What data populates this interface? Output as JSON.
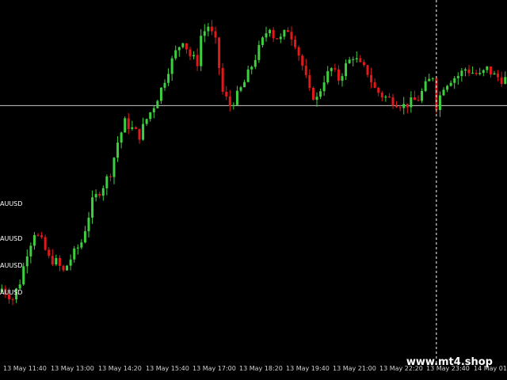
{
  "colors": {
    "background": "#000000",
    "bull": "#3ecf3e",
    "bear": "#e01a1a",
    "hline": "#c8c8c8",
    "crosshair": "#ffffff",
    "text": "#ffffff"
  },
  "side_labels": [
    "AUUSD",
    "AUUSD",
    "AUUSD",
    "AUUSD"
  ],
  "watermark": "www.mt4.shop",
  "chart_data": {
    "type": "candlestick",
    "symbol_labels": [
      "AUUSD",
      "AUUSD",
      "AUUSD",
      "AUUSD"
    ],
    "x_ticks": [
      "13 May 11:40",
      "13 May 13:00",
      "13 May 14:20",
      "13 May 15:40",
      "13 May 17:00",
      "13 May 18:20",
      "13 May 19:40",
      "13 May 21:00",
      "13 May 22:20",
      "13 May 23:40",
      "14 May 01"
    ],
    "horizontal_line": 73,
    "y_range": [
      0,
      100
    ],
    "vertical_line_candle": 120,
    "candle_count": 140,
    "close_path": [
      [
        0,
        18
      ],
      [
        3,
        15
      ],
      [
        5,
        20
      ],
      [
        7,
        29
      ],
      [
        9,
        35
      ],
      [
        11,
        32
      ],
      [
        13,
        27
      ],
      [
        15,
        26
      ],
      [
        17,
        23
      ],
      [
        19,
        27
      ],
      [
        22,
        32
      ],
      [
        25,
        44
      ],
      [
        28,
        49
      ],
      [
        30,
        53
      ],
      [
        32,
        62
      ],
      [
        34,
        68
      ],
      [
        36,
        66
      ],
      [
        38,
        64
      ],
      [
        40,
        69
      ],
      [
        42,
        73
      ],
      [
        44,
        78
      ],
      [
        46,
        84
      ],
      [
        48,
        89
      ],
      [
        50,
        93
      ],
      [
        52,
        88
      ],
      [
        54,
        86
      ],
      [
        55,
        94
      ],
      [
        57,
        97
      ],
      [
        59,
        92
      ],
      [
        61,
        77
      ],
      [
        63,
        73
      ],
      [
        65,
        76
      ],
      [
        67,
        80
      ],
      [
        69,
        85
      ],
      [
        71,
        90
      ],
      [
        73,
        95
      ],
      [
        74,
        97
      ],
      [
        75,
        94
      ],
      [
        77,
        93
      ],
      [
        79,
        96
      ],
      [
        81,
        92
      ],
      [
        83,
        85
      ],
      [
        85,
        77
      ],
      [
        87,
        75
      ],
      [
        89,
        81
      ],
      [
        91,
        84
      ],
      [
        93,
        81
      ],
      [
        95,
        85
      ],
      [
        97,
        88
      ],
      [
        99,
        85
      ],
      [
        101,
        83
      ],
      [
        103,
        78
      ],
      [
        105,
        76
      ],
      [
        107,
        75
      ],
      [
        109,
        74
      ],
      [
        111,
        73
      ],
      [
        113,
        74
      ],
      [
        115,
        75
      ],
      [
        117,
        79
      ],
      [
        119,
        82
      ],
      [
        120,
        73
      ],
      [
        122,
        79
      ],
      [
        124,
        81
      ],
      [
        126,
        82
      ],
      [
        128,
        84
      ],
      [
        130,
        83
      ],
      [
        132,
        82
      ],
      [
        134,
        84
      ],
      [
        136,
        82
      ],
      [
        138,
        81
      ],
      [
        139,
        81
      ]
    ]
  }
}
